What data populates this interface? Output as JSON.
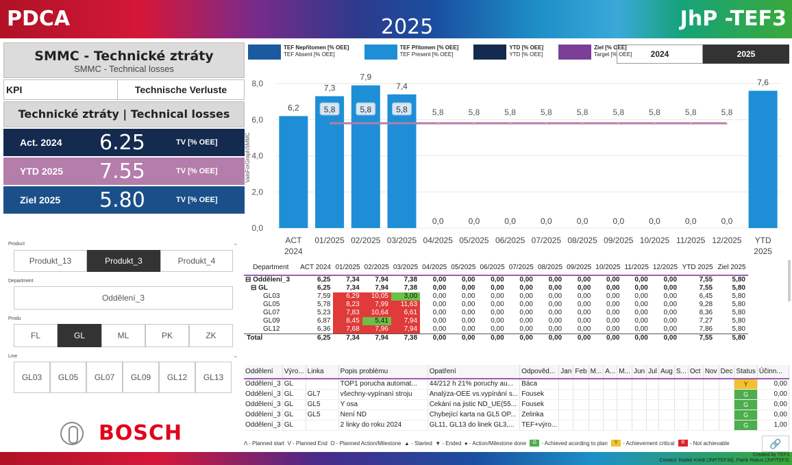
{
  "banner": {
    "left": "PDCA",
    "year": "2025",
    "right": "JhP -TEF3"
  },
  "left": {
    "title": "SMMC - Technické ztráty",
    "subtitle": "SMMC - Technical losses",
    "kpi_label": "KPI",
    "kpi_value": "Technische Verluste",
    "section": "Technické ztráty | Technical losses",
    "cards": [
      {
        "label": "Act. 2024",
        "value": "6.25",
        "unit": "TV [% OEE]"
      },
      {
        "label": "YTD 2025",
        "value": "7.55",
        "unit": "TV [% OEE]"
      },
      {
        "label": "Ziel 2025",
        "value": "5.80",
        "unit": "TV [% OEE]"
      }
    ]
  },
  "slicers": {
    "product": {
      "label": "Product",
      "options": [
        "Produkt_13",
        "Produkt_3",
        "Produkt_4"
      ],
      "selected": "Produkt_3"
    },
    "department": {
      "label": "Department",
      "options": [
        "Oddělení_3"
      ]
    },
    "produ": {
      "label": "Produ",
      "options": [
        "FL",
        "GL",
        "ML",
        "PK",
        "ZK"
      ],
      "selected": "GL"
    },
    "line": {
      "label": "Line",
      "options": [
        "GL03",
        "GL05",
        "GL07",
        "GL09",
        "GL12",
        "GL13"
      ]
    }
  },
  "logo": {
    "text": "BOSCH"
  },
  "legend": [
    {
      "l1": "TEF Nepřítomen [% OEE]",
      "l2": "TEF Absent [% OEE]",
      "color": "#1b5a9e"
    },
    {
      "l1": "TEF Přítomen [% OEE]",
      "l2": "TEF Present [% OEE]",
      "color": "#1e8fd6"
    },
    {
      "l1": "YTD [% OEE]",
      "l2": "YTD [% OEE]",
      "color": "#142a4e"
    },
    {
      "l1": "Ziel [% OEE]",
      "l2": "Target [% OEE]",
      "color": "#7b3f98"
    }
  ],
  "year_toggle": {
    "options": [
      "2024",
      "2025"
    ],
    "selected": "2025"
  },
  "chart_data": {
    "type": "bar",
    "categories": [
      "ACT 2024",
      "01/2025",
      "02/2025",
      "03/2025",
      "04/2025",
      "05/2025",
      "06/2025",
      "07/2025",
      "08/2025",
      "09/2025",
      "10/2025",
      "11/2025",
      "12/2025",
      "YTD 2025"
    ],
    "values": [
      6.2,
      7.3,
      7.9,
      7.4,
      0.0,
      0.0,
      0.0,
      0.0,
      0.0,
      0.0,
      0.0,
      0.0,
      0.0,
      7.6
    ],
    "value_labels": [
      "6,2",
      "7,3",
      "7,9",
      "7,4",
      "0,0",
      "0,0",
      "0,0",
      "0,0",
      "0,0",
      "0,0",
      "0,0",
      "0,0",
      "0,0",
      "7,6"
    ],
    "target": {
      "name": "Ziel [% OEE]",
      "from": "01/2025",
      "to": "12/2025",
      "value": 5.8,
      "label": "5,8"
    },
    "ylabel": "ValsForGraphSMMC",
    "ylim": [
      0,
      8
    ],
    "yticks": [
      "0,0",
      "2,0",
      "4,0",
      "6,0",
      "8,0"
    ],
    "colors": {
      "bar": "#1e8fd6",
      "target": "#b47dab"
    },
    "grid": true
  },
  "matrix": {
    "headers": [
      "Department",
      "ACT 2024",
      "01/2025",
      "02/2025",
      "03/2025",
      "04/2025",
      "05/2025",
      "06/2025",
      "07/2025",
      "08/2025",
      "09/2025",
      "10/2025",
      "11/2025",
      "12/2025",
      "YTD 2025",
      "Ziel 2025"
    ],
    "rows": [
      {
        "name": "⊟ Oddělení_3",
        "bold": true,
        "cells": [
          "6,25",
          "7,34",
          "7,94",
          "7,38",
          "0,00",
          "0,00",
          "0,00",
          "0,00",
          "0,00",
          "0,00",
          "0,00",
          "0,00",
          "0,00",
          "7,55",
          "5,80"
        ]
      },
      {
        "name": "⊟ GL",
        "bold": true,
        "cells": [
          "6,25",
          "7,34",
          "7,94",
          "7,38",
          "0,00",
          "0,00",
          "0,00",
          "0,00",
          "0,00",
          "0,00",
          "0,00",
          "0,00",
          "0,00",
          "7,55",
          "5,80"
        ]
      },
      {
        "name": "GL03",
        "cells": [
          "7,59",
          "6,29",
          "10,05",
          "3,00",
          "0,00",
          "0,00",
          "0,00",
          "0,00",
          "0,00",
          "0,00",
          "0,00",
          "0,00",
          "0,00",
          "6,45",
          "5,80"
        ],
        "colors": [
          "",
          "red",
          "red",
          "green"
        ]
      },
      {
        "name": "GL05",
        "cells": [
          "5,78",
          "8,23",
          "7,99",
          "11,63",
          "0,00",
          "0,00",
          "0,00",
          "0,00",
          "0,00",
          "0,00",
          "0,00",
          "0,00",
          "0,00",
          "9,28",
          "5,80"
        ],
        "colors": [
          "",
          "red",
          "red",
          "red"
        ]
      },
      {
        "name": "GL07",
        "cells": [
          "5,23",
          "7,83",
          "10,64",
          "6,61",
          "0,00",
          "0,00",
          "0,00",
          "0,00",
          "0,00",
          "0,00",
          "0,00",
          "0,00",
          "0,00",
          "8,36",
          "5,80"
        ],
        "colors": [
          "",
          "red",
          "red",
          "red"
        ]
      },
      {
        "name": "GL09",
        "cells": [
          "6,87",
          "8,45",
          "5,41",
          "7,94",
          "0,00",
          "0,00",
          "0,00",
          "0,00",
          "0,00",
          "0,00",
          "0,00",
          "0,00",
          "0,00",
          "7,27",
          "5,80"
        ],
        "colors": [
          "",
          "red",
          "green",
          "red"
        ]
      },
      {
        "name": "GL12",
        "cells": [
          "6,36",
          "7,68",
          "7,96",
          "7,94",
          "0,00",
          "0,00",
          "0,00",
          "0,00",
          "0,00",
          "0,00",
          "0,00",
          "0,00",
          "0,00",
          "7,86",
          "5,80"
        ],
        "colors": [
          "",
          "red",
          "red",
          "red"
        ]
      }
    ],
    "total": {
      "name": "Total",
      "cells": [
        "6,25",
        "7,34",
        "7,94",
        "7,38",
        "0,00",
        "0,00",
        "0,00",
        "0,00",
        "0,00",
        "0,00",
        "0,00",
        "0,00",
        "0,00",
        "7,55",
        "5,80"
      ]
    }
  },
  "actions": {
    "headers": [
      "Oddělení",
      "Výro...",
      "Linka",
      "Popis problému",
      "Opatření",
      "Odpověd...",
      "Jan",
      "Feb",
      "M...",
      "A...",
      "M...",
      "Jun",
      "Jul",
      "Aug",
      "S...",
      "Oct",
      "Nov",
      "Dec",
      "Status",
      "Účinn..."
    ],
    "rows": [
      {
        "c": [
          "Oddělení_3",
          "GL",
          "",
          "TOP1 porucha automat...",
          "44/212 h 21% poruchy au...",
          "Báca"
        ],
        "status": "Y",
        "eff": "0,00"
      },
      {
        "c": [
          "Oddělení_3",
          "GL",
          "GL7",
          "všechny-vypínaní stroju",
          "Analýza-OEE vs.vypínání s...",
          "Fousek"
        ],
        "status": "G",
        "eff": "0,00"
      },
      {
        "c": [
          "Oddělení_3",
          "GL",
          "GL5",
          "Y osa",
          "Cekání na jistic ND_UE(55...",
          "Fousek"
        ],
        "status": "G",
        "eff": "0,00"
      },
      {
        "c": [
          "Oddělení_3",
          "GL",
          "GL5",
          "Není ND",
          "Chybející karta na GL5 OP...",
          "Zelinka"
        ],
        "status": "G",
        "eff": "0,00"
      },
      {
        "c": [
          "Oddělení_3",
          "GL",
          "",
          "2 linky do roku 2024",
          "GL11, GL13 do linek GL3,...",
          "TEF+výro..."
        ],
        "status": "G",
        "eff": "1,00"
      }
    ]
  },
  "keyline": {
    "items": [
      "Λ - Planned start",
      "V - Planned End",
      "O - Planned Action/Milestone",
      "▲ - Started",
      "▼ - Ended",
      "● - Action/Milestone done"
    ],
    "g": "G",
    "g_text": "- Achieved acording to plan",
    "y": "Y",
    "y_text": "- Achievement critical",
    "r": "R",
    "r_text": "- Not achievable"
  },
  "footer": {
    "line1": "Created by TEF3",
    "line2": "Contact: Radek Krédl (JhP/TEF3d), Patrik Rakus (JhP/TEF3)"
  }
}
